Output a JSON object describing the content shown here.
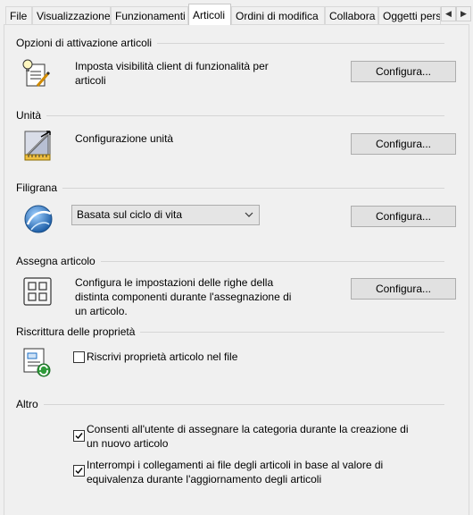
{
  "tabs": [
    {
      "label": "File"
    },
    {
      "label": "Visualizzazione"
    },
    {
      "label": "Funzionamenti"
    },
    {
      "label": "Articoli",
      "active": true
    },
    {
      "label": "Ordini di modifica"
    },
    {
      "label": "Collabora"
    },
    {
      "label": "Oggetti pers"
    }
  ],
  "sections": {
    "activation": {
      "title": "Opzioni di attivazione articoli",
      "description_line1": "Imposta visibilità client di funzionalità per",
      "description_line2": "articoli",
      "button": "Configura...",
      "icon": "lightbulb-list-icon"
    },
    "units": {
      "title": "Unità",
      "description": "Configurazione unità",
      "button": "Configura...",
      "icon": "ruler-units-icon"
    },
    "watermark": {
      "title": "Filigrana",
      "select_value": "Basata sul ciclo di vita",
      "button": "Configura...",
      "icon": "globe-icon"
    },
    "assign": {
      "title": "Assegna articolo",
      "description_line1": "Configura le impostazioni delle righe della",
      "description_line2": "distinta componenti durante l'assegnazione di",
      "description_line3": "un articolo.",
      "button": "Configura...",
      "icon": "grid-assign-icon"
    },
    "writeback": {
      "title": "Riscrittura delle proprietà",
      "checkbox_label": "Riscrivi proprietà articolo nel file",
      "checked": false,
      "icon": "property-sync-icon"
    },
    "other": {
      "title": "Altro",
      "option1_line1": "Consenti all'utente di assegnare la categoria durante la creazione di",
      "option1_line2": "un nuovo articolo",
      "option1_checked": true,
      "option2_line1": "Interrompi i collegamenti ai file degli articoli in base al valore di",
      "option2_line2": "equivalenza durante l'aggiornamento degli articoli",
      "option2_checked": true
    }
  },
  "colors": {
    "button_bg": "#e1e1e1",
    "panel_bg": "#f0f0f0",
    "accent_blue": "#1e6fc4"
  }
}
